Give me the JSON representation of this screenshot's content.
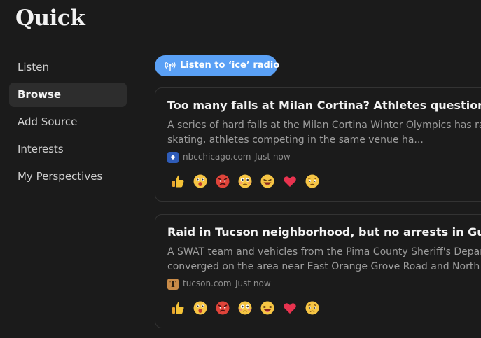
{
  "app": {
    "logo": "Quick"
  },
  "sidebar": {
    "items": [
      {
        "label": "Listen"
      },
      {
        "label": "Browse",
        "active": true
      },
      {
        "label": "Add Source"
      },
      {
        "label": "Interests"
      },
      {
        "label": "My Perspectives"
      }
    ]
  },
  "radio_button": {
    "label": "Listen to ‘ice’ radio",
    "icon": "radio-broadcast-icon",
    "color": "#5aa0f5"
  },
  "articles": [
    {
      "title": "Too many falls at Milan Cortina? Athletes question Olym",
      "description_lines": [
        "A series of hard falls at the Milan Cortina Winter Olympics has raised",
        "skating, athletes competing in the same venue ha..."
      ],
      "source": "nbcchicago.com",
      "favicon_text": "◆",
      "time": "Just now"
    },
    {
      "title": "Raid in Tucson neighborhood, but no arrests in Guthrie c",
      "description_lines": [
        "A SWAT team and vehicles from the Pima County Sheriff's Departm",
        "converged on the area near East Orange Grove Road and North Firs"
      ],
      "source": "tucson.com",
      "favicon_text": "T",
      "time": "Just now"
    }
  ],
  "reactions": [
    "thumbs-up-icon",
    "shocked-face-icon",
    "angry-face-icon",
    "flushed-face-icon",
    "laughing-face-icon",
    "heart-icon",
    "sad-face-icon"
  ],
  "colors": {
    "background": "#1b1b1b",
    "accent": "#5aa0f5",
    "active_nav": "#2d2d2d"
  }
}
